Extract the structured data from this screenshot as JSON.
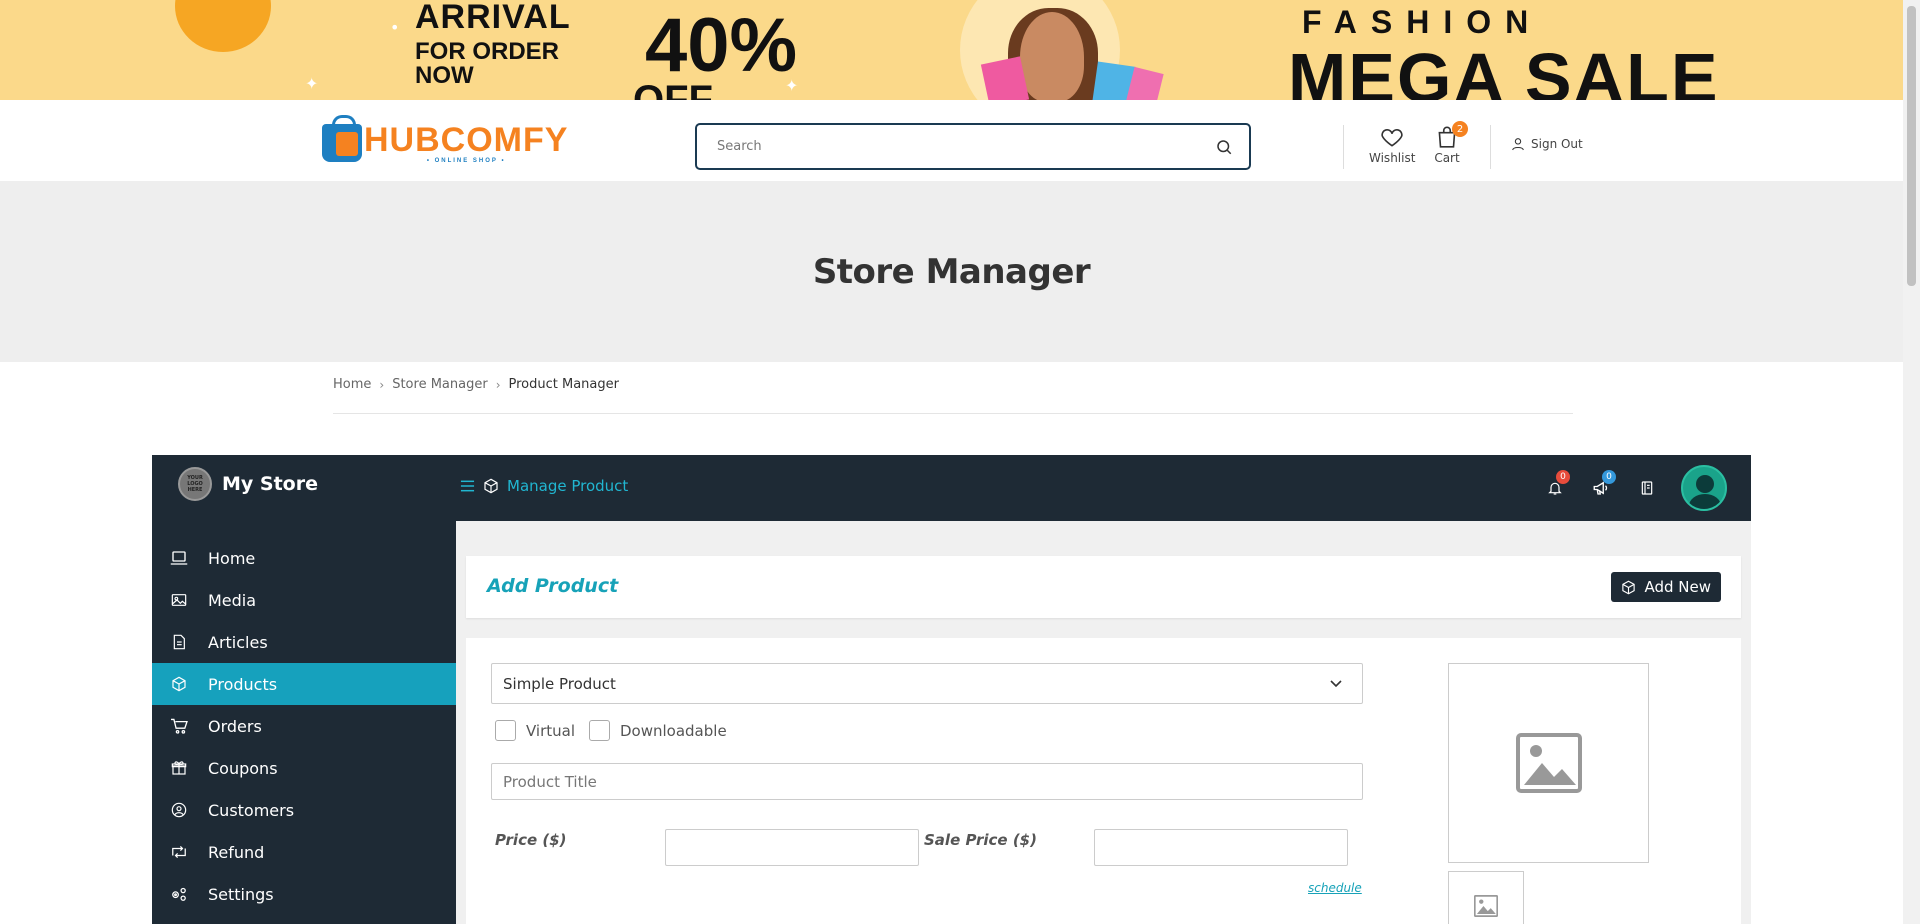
{
  "banner": {
    "arrival": "ARRIVAL",
    "for_order": "FOR ORDER NOW",
    "percent": "40%",
    "off": "OFF",
    "fashion": "FASHION",
    "mega_sale": "MEGA SALE"
  },
  "header": {
    "logo_word": "HUBCOMFY",
    "logo_sub": "• ONLINE SHOP •",
    "search_placeholder": "Search",
    "wishlist_label": "Wishlist",
    "cart_label": "Cart",
    "cart_count": "2",
    "signout_label": "Sign Out"
  },
  "hero": {
    "title": "Store Manager"
  },
  "breadcrumb": {
    "items": [
      "Home",
      "Store Manager",
      "Product Manager"
    ]
  },
  "dashboard": {
    "store_name": "My Store",
    "store_logo_text": "YOUR LOGO HERE",
    "manage_label": "Manage Product",
    "notifications_count": "0",
    "announcements_count": "0",
    "colors": {
      "dark": "#1e2a35",
      "accent": "#16a1bd",
      "badge_red": "#e74c3c",
      "badge_blue": "#3498db"
    }
  },
  "sidebar": {
    "items": [
      {
        "label": "Home",
        "icon": "laptop-icon"
      },
      {
        "label": "Media",
        "icon": "image-icon"
      },
      {
        "label": "Articles",
        "icon": "document-icon"
      },
      {
        "label": "Products",
        "icon": "cube-icon",
        "active": true
      },
      {
        "label": "Orders",
        "icon": "cart-icon"
      },
      {
        "label": "Coupons",
        "icon": "gift-icon"
      },
      {
        "label": "Customers",
        "icon": "user-circle-icon"
      },
      {
        "label": "Refund",
        "icon": "retweet-icon"
      },
      {
        "label": "Settings",
        "icon": "cogs-icon"
      }
    ]
  },
  "product_form": {
    "title": "Add Product",
    "add_new_label": "Add New",
    "product_type": "Simple Product",
    "virtual_label": "Virtual",
    "downloadable_label": "Downloadable",
    "title_placeholder": "Product Title",
    "price_label": "Price ($)",
    "sale_price_label": "Sale Price ($)",
    "schedule_label": "schedule"
  }
}
